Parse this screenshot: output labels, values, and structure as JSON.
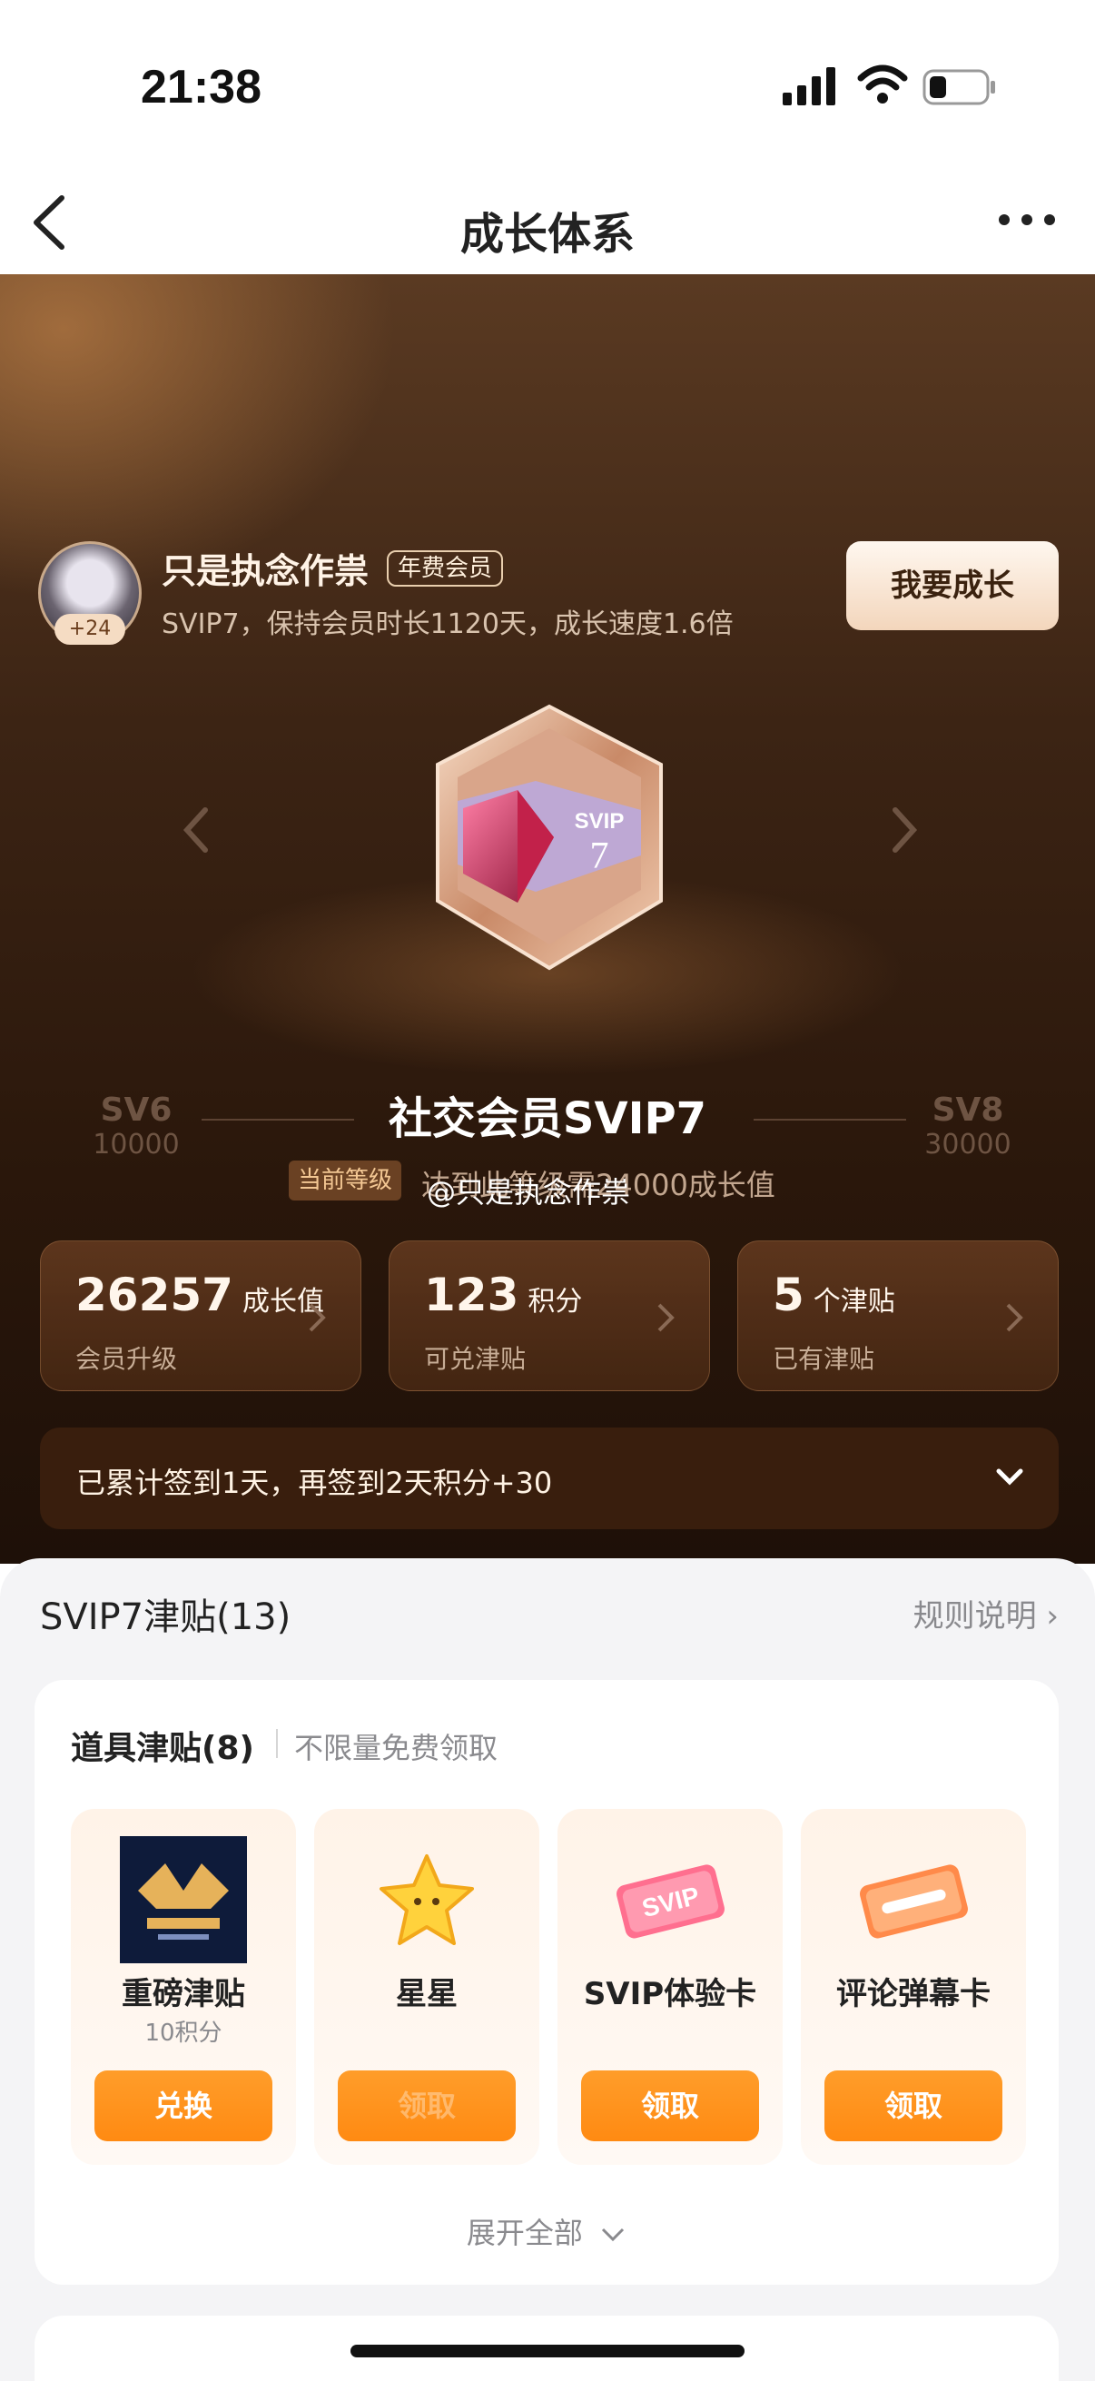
{
  "status": {
    "time": "21:38"
  },
  "nav": {
    "title": "成长体系"
  },
  "user": {
    "name": "只是执念作祟",
    "badge": "年费会员",
    "avatar_badge": "+24",
    "subtitle": "SVIP7，保持会员时长1120天，成长速度1.6倍",
    "grow_button": "我要成长"
  },
  "level": {
    "title": "社交会员SVIP7",
    "current_badge": "当前等级",
    "current_text": "达到此等级需24000成长值",
    "medal_text": "SVIP",
    "medal_num": "7",
    "prev": {
      "name": "SV6",
      "value": "10000"
    },
    "next": {
      "name": "SV8",
      "value": "30000"
    }
  },
  "watermark": "@只是执念作祟",
  "stats": [
    {
      "value": "26257",
      "unit": "成长值",
      "label": "会员升级"
    },
    {
      "value": "123",
      "unit": "积分",
      "label": "可兑津贴"
    },
    {
      "value": "5",
      "unit": "个津贴",
      "label": "已有津贴"
    }
  ],
  "checkin": {
    "text": "已累计签到1天，再签到2天积分+30"
  },
  "allowance": {
    "title": "SVIP7津贴(13)",
    "rules": "规则说明 ›",
    "card_title": "道具津贴(8)",
    "card_sub": "不限量免费领取",
    "items": [
      {
        "name": "重磅津贴",
        "price": "10积分",
        "button": "兑换",
        "icon": "music-festival-icon"
      },
      {
        "name": "星星",
        "price": "",
        "button": "领取",
        "icon": "star-icon"
      },
      {
        "name": "SVIP体验卡",
        "price": "",
        "button": "领取",
        "icon": "svip-card-icon"
      },
      {
        "name": "评论弹幕卡",
        "price": "",
        "button": "领取",
        "icon": "comment-card-icon"
      }
    ],
    "expand": "展开全部"
  },
  "colors": {
    "accent": "#ff8a12",
    "hero_dark": "#2a170b"
  }
}
